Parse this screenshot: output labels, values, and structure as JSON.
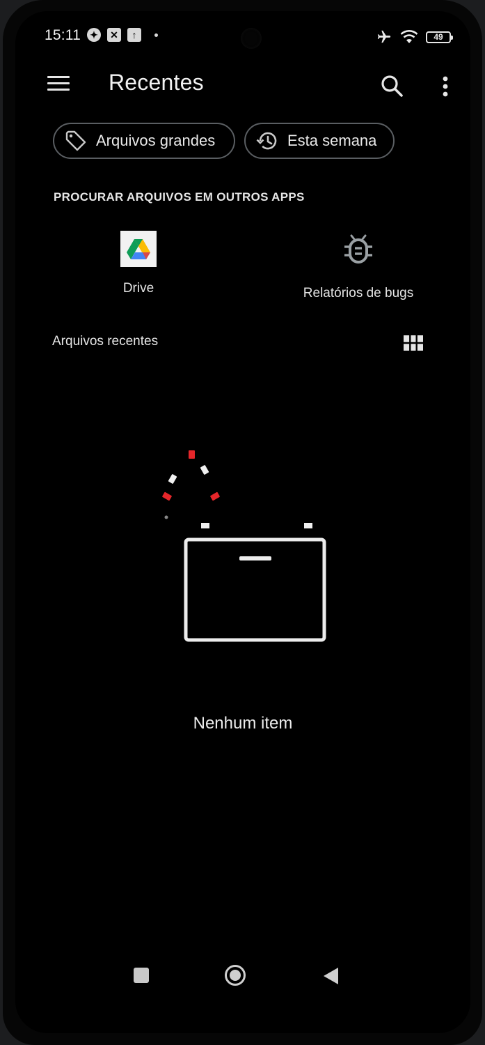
{
  "status_bar": {
    "time": "15:11",
    "battery": "49"
  },
  "app_bar": {
    "title": "Recentes"
  },
  "chips": [
    {
      "label": "Arquivos grandes",
      "icon": "tag-icon"
    },
    {
      "label": "Esta semana",
      "icon": "history-icon"
    }
  ],
  "other_apps": {
    "heading": "PROCURAR ARQUIVOS EM OUTROS APPS",
    "apps": [
      {
        "label": "Drive",
        "icon": "google-drive-icon"
      },
      {
        "label": "Relatórios de bugs",
        "icon": "bug-icon"
      }
    ]
  },
  "recent_files": {
    "heading": "Arquivos recentes",
    "empty_message": "Nenhum item"
  },
  "colors": {
    "background": "#000000",
    "accent_red": "#e5262a",
    "chip_border": "#5a5e62",
    "text": "#e8e8e8"
  }
}
